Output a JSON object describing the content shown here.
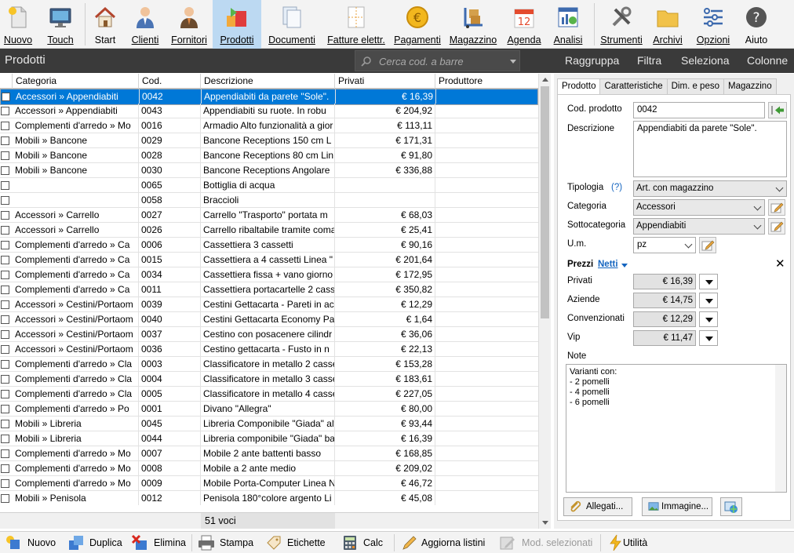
{
  "toolbar": {
    "items": [
      {
        "label": "Nuovo",
        "icon": "new-document-icon"
      },
      {
        "label": "Touch",
        "icon": "touch-monitor-icon"
      },
      {
        "label": "Start",
        "icon": "home-icon"
      },
      {
        "label": "Clienti",
        "icon": "customer-icon"
      },
      {
        "label": "Fornitori",
        "icon": "supplier-icon"
      },
      {
        "label": "Prodotti",
        "icon": "products-icon"
      },
      {
        "label": "Documenti",
        "icon": "documents-icon"
      },
      {
        "label": "Fatture elettr.",
        "icon": "e-invoice-icon"
      },
      {
        "label": "Pagamenti",
        "icon": "euro-coin-icon"
      },
      {
        "label": "Magazzino",
        "icon": "warehouse-icon"
      },
      {
        "label": "Agenda",
        "icon": "calendar-icon"
      },
      {
        "label": "Analisi",
        "icon": "analysis-icon"
      },
      {
        "label": "Strumenti",
        "icon": "tools-icon"
      },
      {
        "label": "Archivi",
        "icon": "archives-icon"
      },
      {
        "label": "Opzioni",
        "icon": "options-icon"
      },
      {
        "label": "Aiuto",
        "icon": "help-icon"
      }
    ],
    "active": "Prodotti",
    "calendar_day": "12"
  },
  "titlebar": {
    "title": "Prodotti",
    "search_placeholder": "Cerca cod. a barre",
    "menu": [
      "Raggruppa",
      "Filtra",
      "Seleziona",
      "Colonne"
    ]
  },
  "grid": {
    "columns": [
      "Categoria",
      "Cod.",
      "Descrizione",
      "Privati",
      "Produttore"
    ],
    "rows": [
      {
        "cat": "Accessori  »  Appendiabiti",
        "code": "0042",
        "desc": "Appendiabiti da parete \"Sole\".",
        "price": "€ 16,39",
        "selected": true
      },
      {
        "cat": "Accessori  »  Appendiabiti",
        "code": "0043",
        "desc": "Appendiabiti su ruote. In robu",
        "price": "€ 204,92"
      },
      {
        "cat": "Complementi d'arredo  »  Mo",
        "code": "0016",
        "desc": "Armadio Alto funzionalità a gior",
        "price": "€ 113,11"
      },
      {
        "cat": "Mobili  »  Bancone",
        "code": "0029",
        "desc": "Bancone Receptions 150 cm L",
        "price": "€ 171,31"
      },
      {
        "cat": "Mobili  »  Bancone",
        "code": "0028",
        "desc": "Bancone Receptions 80 cm Lin",
        "price": "€ 91,80"
      },
      {
        "cat": "Mobili  »  Bancone",
        "code": "0030",
        "desc": "Bancone Receptions Angolare",
        "price": "€ 336,88"
      },
      {
        "cat": "",
        "code": "0065",
        "desc": "Bottiglia di acqua",
        "price": ""
      },
      {
        "cat": "",
        "code": "0058",
        "desc": "Braccioli",
        "price": ""
      },
      {
        "cat": "Accessori  »  Carrello",
        "code": "0027",
        "desc": "Carrello \"Trasporto\"  portata m",
        "price": "€ 68,03"
      },
      {
        "cat": "Accessori  »  Carrello",
        "code": "0026",
        "desc": "Carrello ribaltabile tramite coma",
        "price": "€ 25,41"
      },
      {
        "cat": "Complementi d'arredo  »  Ca",
        "code": "0006",
        "desc": "Cassettiera 3 cassetti",
        "price": "€ 90,16"
      },
      {
        "cat": "Complementi d'arredo  »  Ca",
        "code": "0015",
        "desc": "Cassettiera a 4 cassetti Linea \"",
        "price": "€ 201,64"
      },
      {
        "cat": "Complementi d'arredo  »  Ca",
        "code": "0034",
        "desc": "Cassettiera fissa + vano giorno",
        "price": "€ 172,95"
      },
      {
        "cat": "Complementi d'arredo  »  Ca",
        "code": "0011",
        "desc": "Cassettiera portacartelle 2 cass",
        "price": "€ 350,82"
      },
      {
        "cat": "Accessori  »  Cestini/Portaom",
        "code": "0039",
        "desc": "Cestini Gettacarta - Pareti in ac",
        "price": "€ 12,29"
      },
      {
        "cat": "Accessori  »  Cestini/Portaom",
        "code": "0040",
        "desc": "Cestini Gettacarta Economy Pa",
        "price": "€ 1,64"
      },
      {
        "cat": "Accessori  »  Cestini/Portaom",
        "code": "0037",
        "desc": "Cestino con posacenere cilindr",
        "price": "€ 36,06"
      },
      {
        "cat": "Accessori  »  Cestini/Portaom",
        "code": "0036",
        "desc": "Cestino gettacarta - Fusto in n",
        "price": "€ 22,13"
      },
      {
        "cat": "Complementi d'arredo  »  Cla",
        "code": "0003",
        "desc": "Classificatore in metallo 2 casse",
        "price": "€ 153,28"
      },
      {
        "cat": "Complementi d'arredo  »  Cla",
        "code": "0004",
        "desc": "Classificatore in metallo 3 casse",
        "price": "€ 183,61"
      },
      {
        "cat": "Complementi d'arredo  »  Cla",
        "code": "0005",
        "desc": "Classificatore in metallo 4 casse",
        "price": "€ 227,05"
      },
      {
        "cat": "Complementi d'arredo  »  Po",
        "code": "0001",
        "desc": "Divano \"Allegra\"",
        "price": "€ 80,00"
      },
      {
        "cat": "Mobili  »  Libreria",
        "code": "0045",
        "desc": "Libreria Componibile \"Giada\" alt",
        "price": "€ 93,44"
      },
      {
        "cat": "Mobili  »  Libreria",
        "code": "0044",
        "desc": "Libreria componibile \"Giada\" ba",
        "price": "€ 16,39"
      },
      {
        "cat": "Complementi d'arredo  »  Mo",
        "code": "0007",
        "desc": "Mobile 2 ante battenti basso",
        "price": "€ 168,85"
      },
      {
        "cat": "Complementi d'arredo  »  Mo",
        "code": "0008",
        "desc": "Mobile a 2 ante medio",
        "price": "€ 209,02"
      },
      {
        "cat": "Complementi d'arredo  »  Mo",
        "code": "0009",
        "desc": "Mobile Porta-Computer Linea N",
        "price": "€ 46,72"
      },
      {
        "cat": "Mobili  »  Penisola",
        "code": "0012",
        "desc": "Penisola 180°colore argento Li",
        "price": "€ 45,08"
      }
    ],
    "count": "51 voci"
  },
  "panel": {
    "tabs": [
      "Prodotto",
      "Caratteristiche",
      "Dim. e peso",
      "Magazzino"
    ],
    "code_label": "Cod. prodotto",
    "code_value": "0042",
    "desc_label": "Descrizione",
    "desc_value": "Appendiabiti da parete \"Sole\".",
    "tipologia_label": "Tipologia",
    "tipologia_help": "(?)",
    "tipologia_value": "Art. con magazzino",
    "categoria_label": "Categoria",
    "categoria_value": "Accessori",
    "sottocategoria_label": "Sottocategoria",
    "sottocategoria_value": "Appendiabiti",
    "um_label": "U.m.",
    "um_value": "pz",
    "prezzi_label": "Prezzi",
    "netti_label": "Netti",
    "prices": [
      {
        "label": "Privati",
        "value": "€ 16,39"
      },
      {
        "label": "Aziende",
        "value": "€ 14,75"
      },
      {
        "label": "Convenzionati",
        "value": "€ 12,29"
      },
      {
        "label": "Vip",
        "value": "€ 11,47"
      }
    ],
    "note_label": "Note",
    "notes": [
      "Varianti con:",
      "- 2 pomelli",
      "- 4 pomelli",
      "- 6 pomelli"
    ],
    "allegati_label": "Allegati...",
    "immagine_label": "Immagine..."
  },
  "bottom": {
    "items": [
      {
        "label": "Nuovo",
        "icon": "new-icon",
        "enabled": true
      },
      {
        "label": "Duplica",
        "icon": "duplicate-icon",
        "enabled": true
      },
      {
        "label": "Elimina",
        "icon": "delete-icon",
        "enabled": true
      },
      {
        "label": "Stampa",
        "icon": "print-icon",
        "enabled": true
      },
      {
        "label": "Etichette",
        "icon": "labels-icon",
        "enabled": true
      },
      {
        "label": "Calc",
        "icon": "calc-icon",
        "enabled": true
      },
      {
        "label": "Aggiorna listini",
        "icon": "update-pricelists-icon",
        "enabled": true
      },
      {
        "label": "Mod. selezionati",
        "icon": "edit-selected-icon",
        "enabled": false
      },
      {
        "label": "Utilità",
        "icon": "utility-icon",
        "enabled": true
      }
    ]
  },
  "colors": {
    "selection": "#0078d7",
    "titlebar": "#3a3a3a",
    "toolbar_active": "#bcd9f2",
    "link": "#1565c0"
  }
}
